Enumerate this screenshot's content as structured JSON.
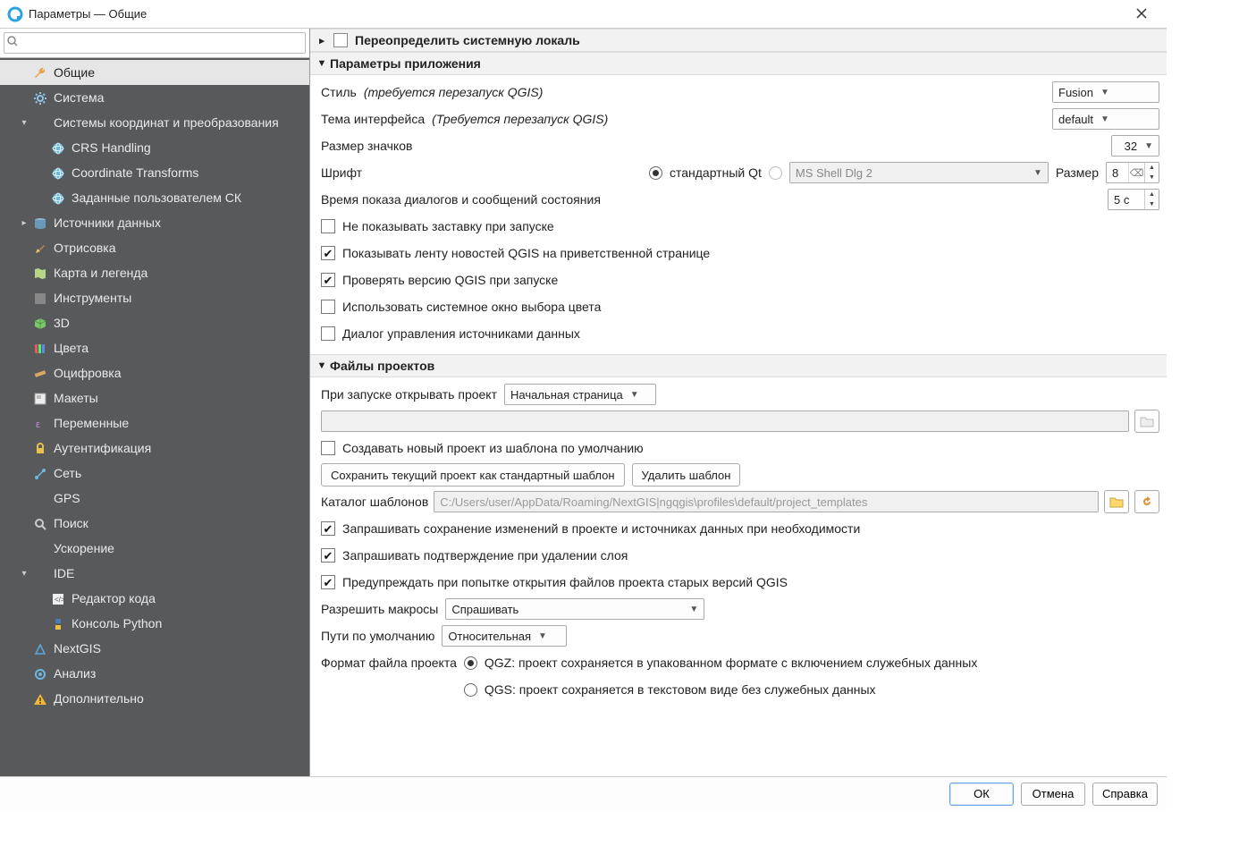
{
  "window": {
    "title": "Параметры — Общие"
  },
  "search": {
    "placeholder": ""
  },
  "sidebar": [
    {
      "label": "Общие",
      "level": 1,
      "expander": "",
      "icon": "wrench",
      "selected": true
    },
    {
      "label": "Система",
      "level": 1,
      "expander": "",
      "icon": "gear"
    },
    {
      "label": "Системы координат и преобразования",
      "level": 1,
      "expander": "▾",
      "icon": ""
    },
    {
      "label": "CRS Handling",
      "level": 2,
      "expander": "",
      "icon": "globe"
    },
    {
      "label": "Coordinate Transforms",
      "level": 2,
      "expander": "",
      "icon": "globe"
    },
    {
      "label": "Заданные пользователем СК",
      "level": 2,
      "expander": "",
      "icon": "globe"
    },
    {
      "label": "Источники данных",
      "level": 1,
      "expander": "▸",
      "icon": "db"
    },
    {
      "label": "Отрисовка",
      "level": 1,
      "expander": "",
      "icon": "brush"
    },
    {
      "label": "Карта и легенда",
      "level": 1,
      "expander": "",
      "icon": "map"
    },
    {
      "label": "Инструменты",
      "level": 1,
      "expander": "",
      "icon": "tools"
    },
    {
      "label": "3D",
      "level": 1,
      "expander": "",
      "icon": "cube"
    },
    {
      "label": "Цвета",
      "level": 1,
      "expander": "",
      "icon": "palette"
    },
    {
      "label": "Оцифровка",
      "level": 1,
      "expander": "",
      "icon": "pencil"
    },
    {
      "label": "Макеты",
      "level": 1,
      "expander": "",
      "icon": "layout"
    },
    {
      "label": "Переменные",
      "level": 1,
      "expander": "",
      "icon": "var"
    },
    {
      "label": "Аутентификация",
      "level": 1,
      "expander": "",
      "icon": "lock"
    },
    {
      "label": "Сеть",
      "level": 1,
      "expander": "",
      "icon": "net"
    },
    {
      "label": "GPS",
      "level": 1,
      "expander": "",
      "icon": ""
    },
    {
      "label": "Поиск",
      "level": 1,
      "expander": "",
      "icon": "search"
    },
    {
      "label": "Ускорение",
      "level": 1,
      "expander": "",
      "icon": ""
    },
    {
      "label": "IDE",
      "level": 1,
      "expander": "▾",
      "icon": ""
    },
    {
      "label": "Редактор кода",
      "level": 2,
      "expander": "",
      "icon": "code"
    },
    {
      "label": "Консоль Python",
      "level": 2,
      "expander": "",
      "icon": "python"
    },
    {
      "label": "NextGIS",
      "level": 1,
      "expander": "",
      "icon": "nextgis"
    },
    {
      "label": "Анализ",
      "level": 1,
      "expander": "",
      "icon": "gear2"
    },
    {
      "label": "Дополнительно",
      "level": 1,
      "expander": "",
      "icon": "warning"
    }
  ],
  "sections": {
    "locale": {
      "title": "Переопределить системную локаль",
      "checked": false,
      "expanded": false
    },
    "app": {
      "title": "Параметры приложения",
      "style_label": "Стиль",
      "style_hint": "(требуется перезапуск QGIS)",
      "style_value": "Fusion",
      "theme_label": "Тема интерфейса",
      "theme_hint": "(Требуется перезапуск QGIS)",
      "theme_value": "default",
      "iconsize_label": "Размер значков",
      "iconsize_value": "32",
      "font_label": "Шрифт",
      "font_std_label": "стандартный Qt",
      "font_custom_value": "MS Shell Dlg 2",
      "font_size_label": "Размер",
      "font_size_value": "8",
      "msgtime_label": "Время показа диалогов и сообщений состояния",
      "msgtime_value": "5 с",
      "chk_splash": "Не показывать заставку при запуске",
      "chk_news": "Показывать ленту новостей QGIS на приветственной странице",
      "chk_version": "Проверять версию QGIS при запуске",
      "chk_native_color": "Использовать системное окно выбора цвета",
      "chk_datasource_dlg": "Диалог управления источниками данных"
    },
    "projects": {
      "title": "Файлы проектов",
      "open_label": "При запуске открывать проект",
      "open_value": "Начальная страница",
      "template_chk": "Создавать новый проект из шаблона по умолчанию",
      "save_template_btn": "Сохранить текущий проект как стандартный шаблон",
      "delete_template_btn": "Удалить шаблон",
      "template_dir_label": "Каталог шаблонов",
      "template_dir_value": "C:/Users/user/AppData/Roaming/NextGIS|ngqgis\\profiles\\default/project_templates",
      "chk_prompt_save": "Запрашивать сохранение изменений в проекте и источниках данных при необходимости",
      "chk_confirm_delete": "Запрашивать подтверждение при удалении слоя",
      "chk_warn_old": "Предупреждать при попытке открытия файлов проекта старых версий QGIS",
      "macros_label": "Разрешить макросы",
      "macros_value": "Спрашивать",
      "paths_label": "Пути по умолчанию",
      "paths_value": "Относительная",
      "format_label": "Формат файла проекта",
      "format_qgz": "QGZ: проект сохраняется в упакованном формате с включением служебных данных",
      "format_qgs": "QGS: проект сохраняется в текстовом виде без служебных данных"
    }
  },
  "footer": {
    "ok": "ОК",
    "cancel": "Отмена",
    "help": "Справка"
  }
}
